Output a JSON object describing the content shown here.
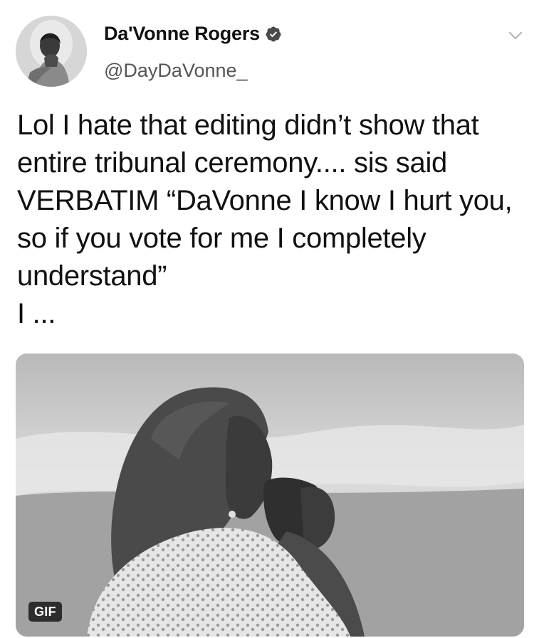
{
  "author": {
    "display_name": "Da'Vonne Rogers",
    "handle": "@DayDaVonne_",
    "verified": true,
    "avatar_icon": "profile-photo"
  },
  "tweet": {
    "text": "Lol I hate that editing didn’t show that entire tribunal ceremony.... sis said VERBATIM “DaVonne I know I hurt you, so if you vote for me I completely understand”\nI ..."
  },
  "media": {
    "type": "gif",
    "badge_label": "GIF",
    "description_icon": "woman-praying-gif"
  },
  "icons": {
    "verified": "verified-badge-icon",
    "menu": "chevron-down-icon"
  },
  "colors": {
    "text": "#111111",
    "handle": "#555555",
    "verified_badge": "#4a4a4a"
  }
}
